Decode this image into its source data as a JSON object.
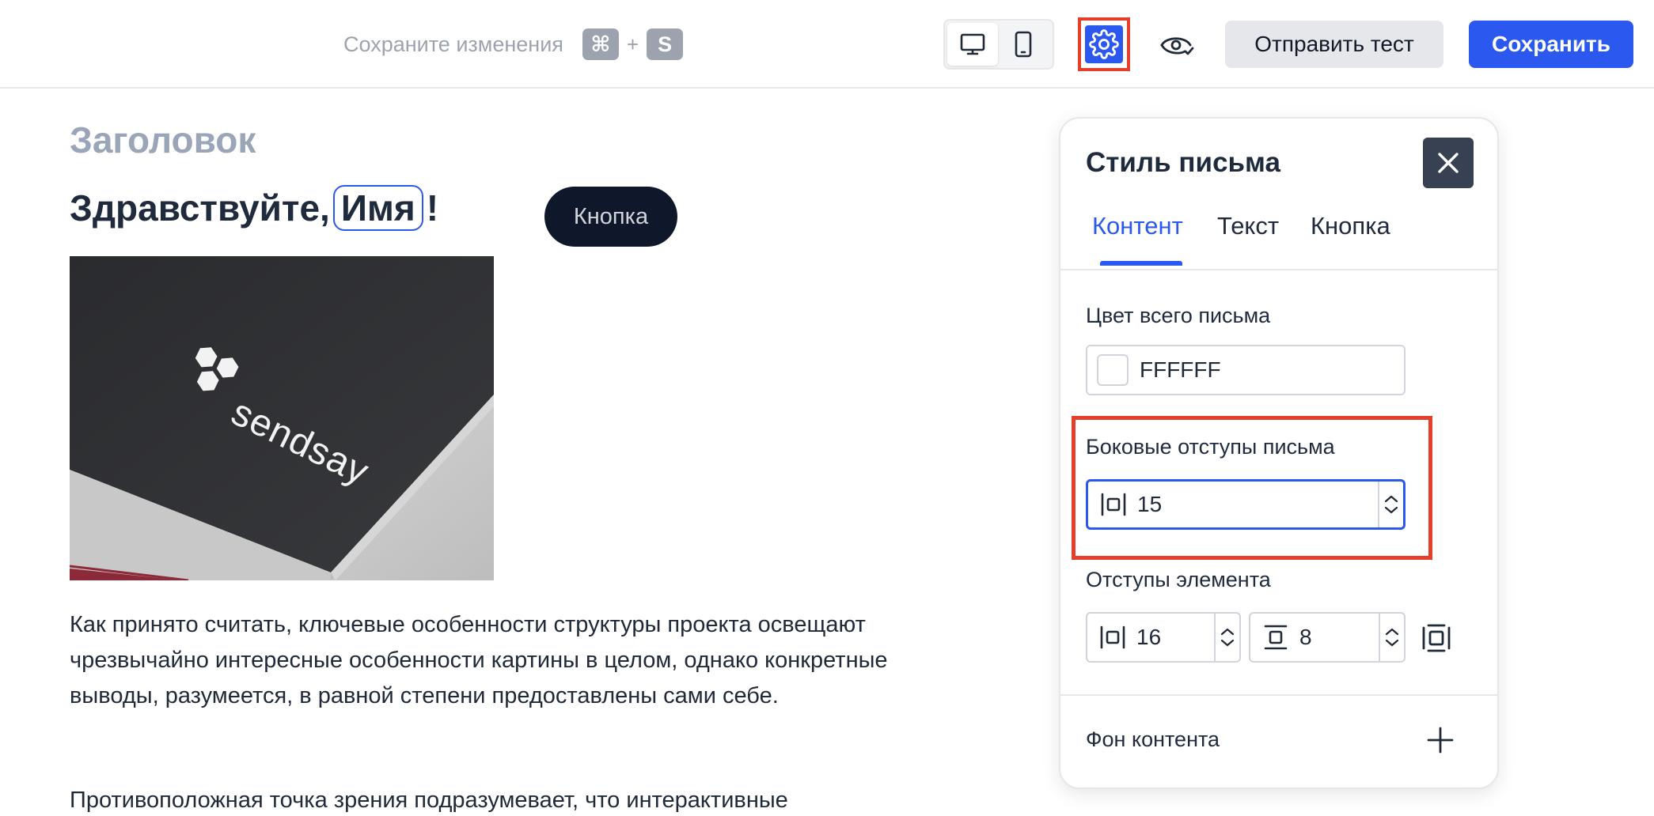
{
  "toolbar": {
    "save_hint": "Сохраните изменения",
    "shortcut_cmd": "⌘",
    "shortcut_plus": "+",
    "shortcut_key": "S",
    "send_test_label": "Отправить тест",
    "save_label": "Сохранить",
    "devices": [
      {
        "name": "desktop",
        "icon": "desktop-icon",
        "active": true
      },
      {
        "name": "mobile",
        "icon": "mobile-icon",
        "active": false
      }
    ],
    "settings_icon": "gear-icon",
    "preview_icon": "eye-check-icon"
  },
  "email": {
    "heading": "Заголовок",
    "greeting_prefix": "Здравствуйте, ",
    "greeting_name": "Имя",
    "greeting_suffix": "!",
    "button_label": "Кнопка",
    "image_logo_text": "sendsay",
    "paragraph_1": "Как принято считать, ключевые особенности структуры проекта освещают чрезвычайно интересные особенности картины в целом, однако конкретные выводы, разумеется, в равной степени предоставлены сами себе.",
    "paragraph_2": "Противоположная точка зрения подразумевает, что интерактивные"
  },
  "panel": {
    "title": "Стиль письма",
    "close_icon": "close-icon",
    "tabs": [
      {
        "label": "Контент",
        "active": true
      },
      {
        "label": "Текст",
        "active": false
      },
      {
        "label": "Кнопка",
        "active": false
      }
    ],
    "email_color_label": "Цвет всего письма",
    "email_color_value": "FFFFFF",
    "side_padding_label": "Боковые отступы письма",
    "side_padding_value": "15",
    "element_padding_label": "Отступы элемента",
    "element_padding_horizontal": "16",
    "element_padding_vertical": "8",
    "content_bg_label": "Фон контента"
  },
  "colors": {
    "accent": "#2b59f0",
    "highlight": "#e53e2a",
    "dark_button": "#0f172a",
    "heading_muted": "#9aa5b8"
  }
}
